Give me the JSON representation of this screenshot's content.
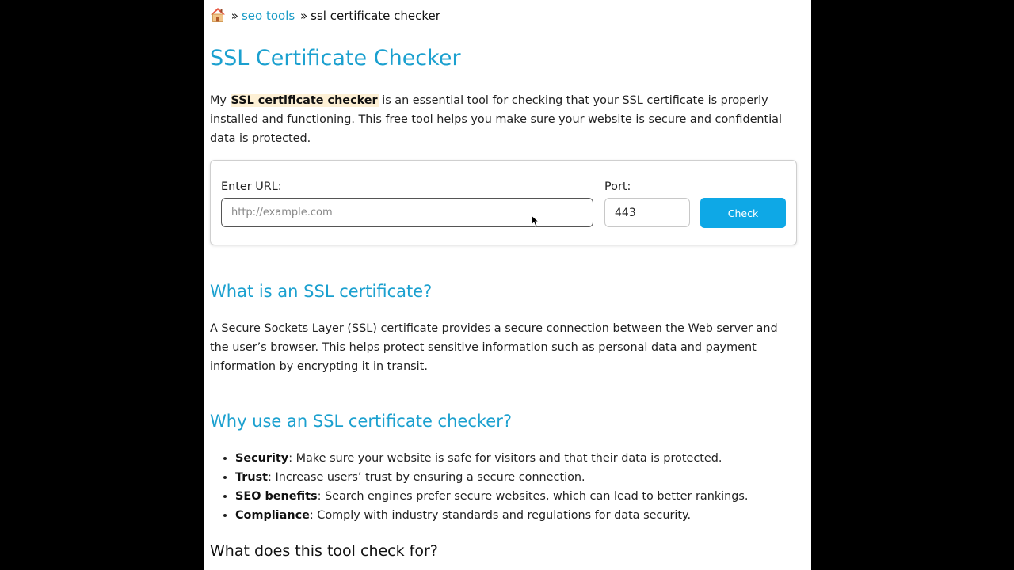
{
  "breadcrumb": {
    "home_icon": "home-icon",
    "separator": "»",
    "parent_label": "seo tools",
    "current_label": "ssl certificate checker"
  },
  "title": "SSL Certificate Checker",
  "intro": {
    "prefix": "My ",
    "highlight": "SSL certificate checker",
    "suffix": " is an essential tool for checking that your SSL certificate is properly installed and functioning. This free tool helps you make sure your website is secure and confidential data is protected."
  },
  "checker": {
    "url_label": "Enter URL:",
    "url_placeholder": "http://example.com",
    "port_label": "Port:",
    "port_value": "443",
    "button_label": "Check"
  },
  "what": {
    "heading": "What is an SSL certificate?",
    "body": "A Secure Sockets Layer (SSL) certificate provides a secure connection between the Web server and the user’s browser. This helps protect sensitive information such as personal data and payment information by encrypting it in transit."
  },
  "why": {
    "heading": "Why use an SSL certificate checker?",
    "items": [
      {
        "term": "Security",
        "text": ": Make sure your website is safe for visitors and that their data is protected."
      },
      {
        "term": "Trust",
        "text": ": Increase users’ trust by ensuring a secure connection."
      },
      {
        "term": "SEO benefits",
        "text": ": Search engines prefer secure websites, which can lead to better rankings."
      },
      {
        "term": "Compliance",
        "text": ": Comply with industry standards and regulations for data security."
      }
    ]
  },
  "checks": {
    "heading": "What does this tool check for?"
  },
  "colors": {
    "accent": "#1ba0cf",
    "button": "#0ea8e6",
    "highlight_bg": "#fdf0d5"
  }
}
